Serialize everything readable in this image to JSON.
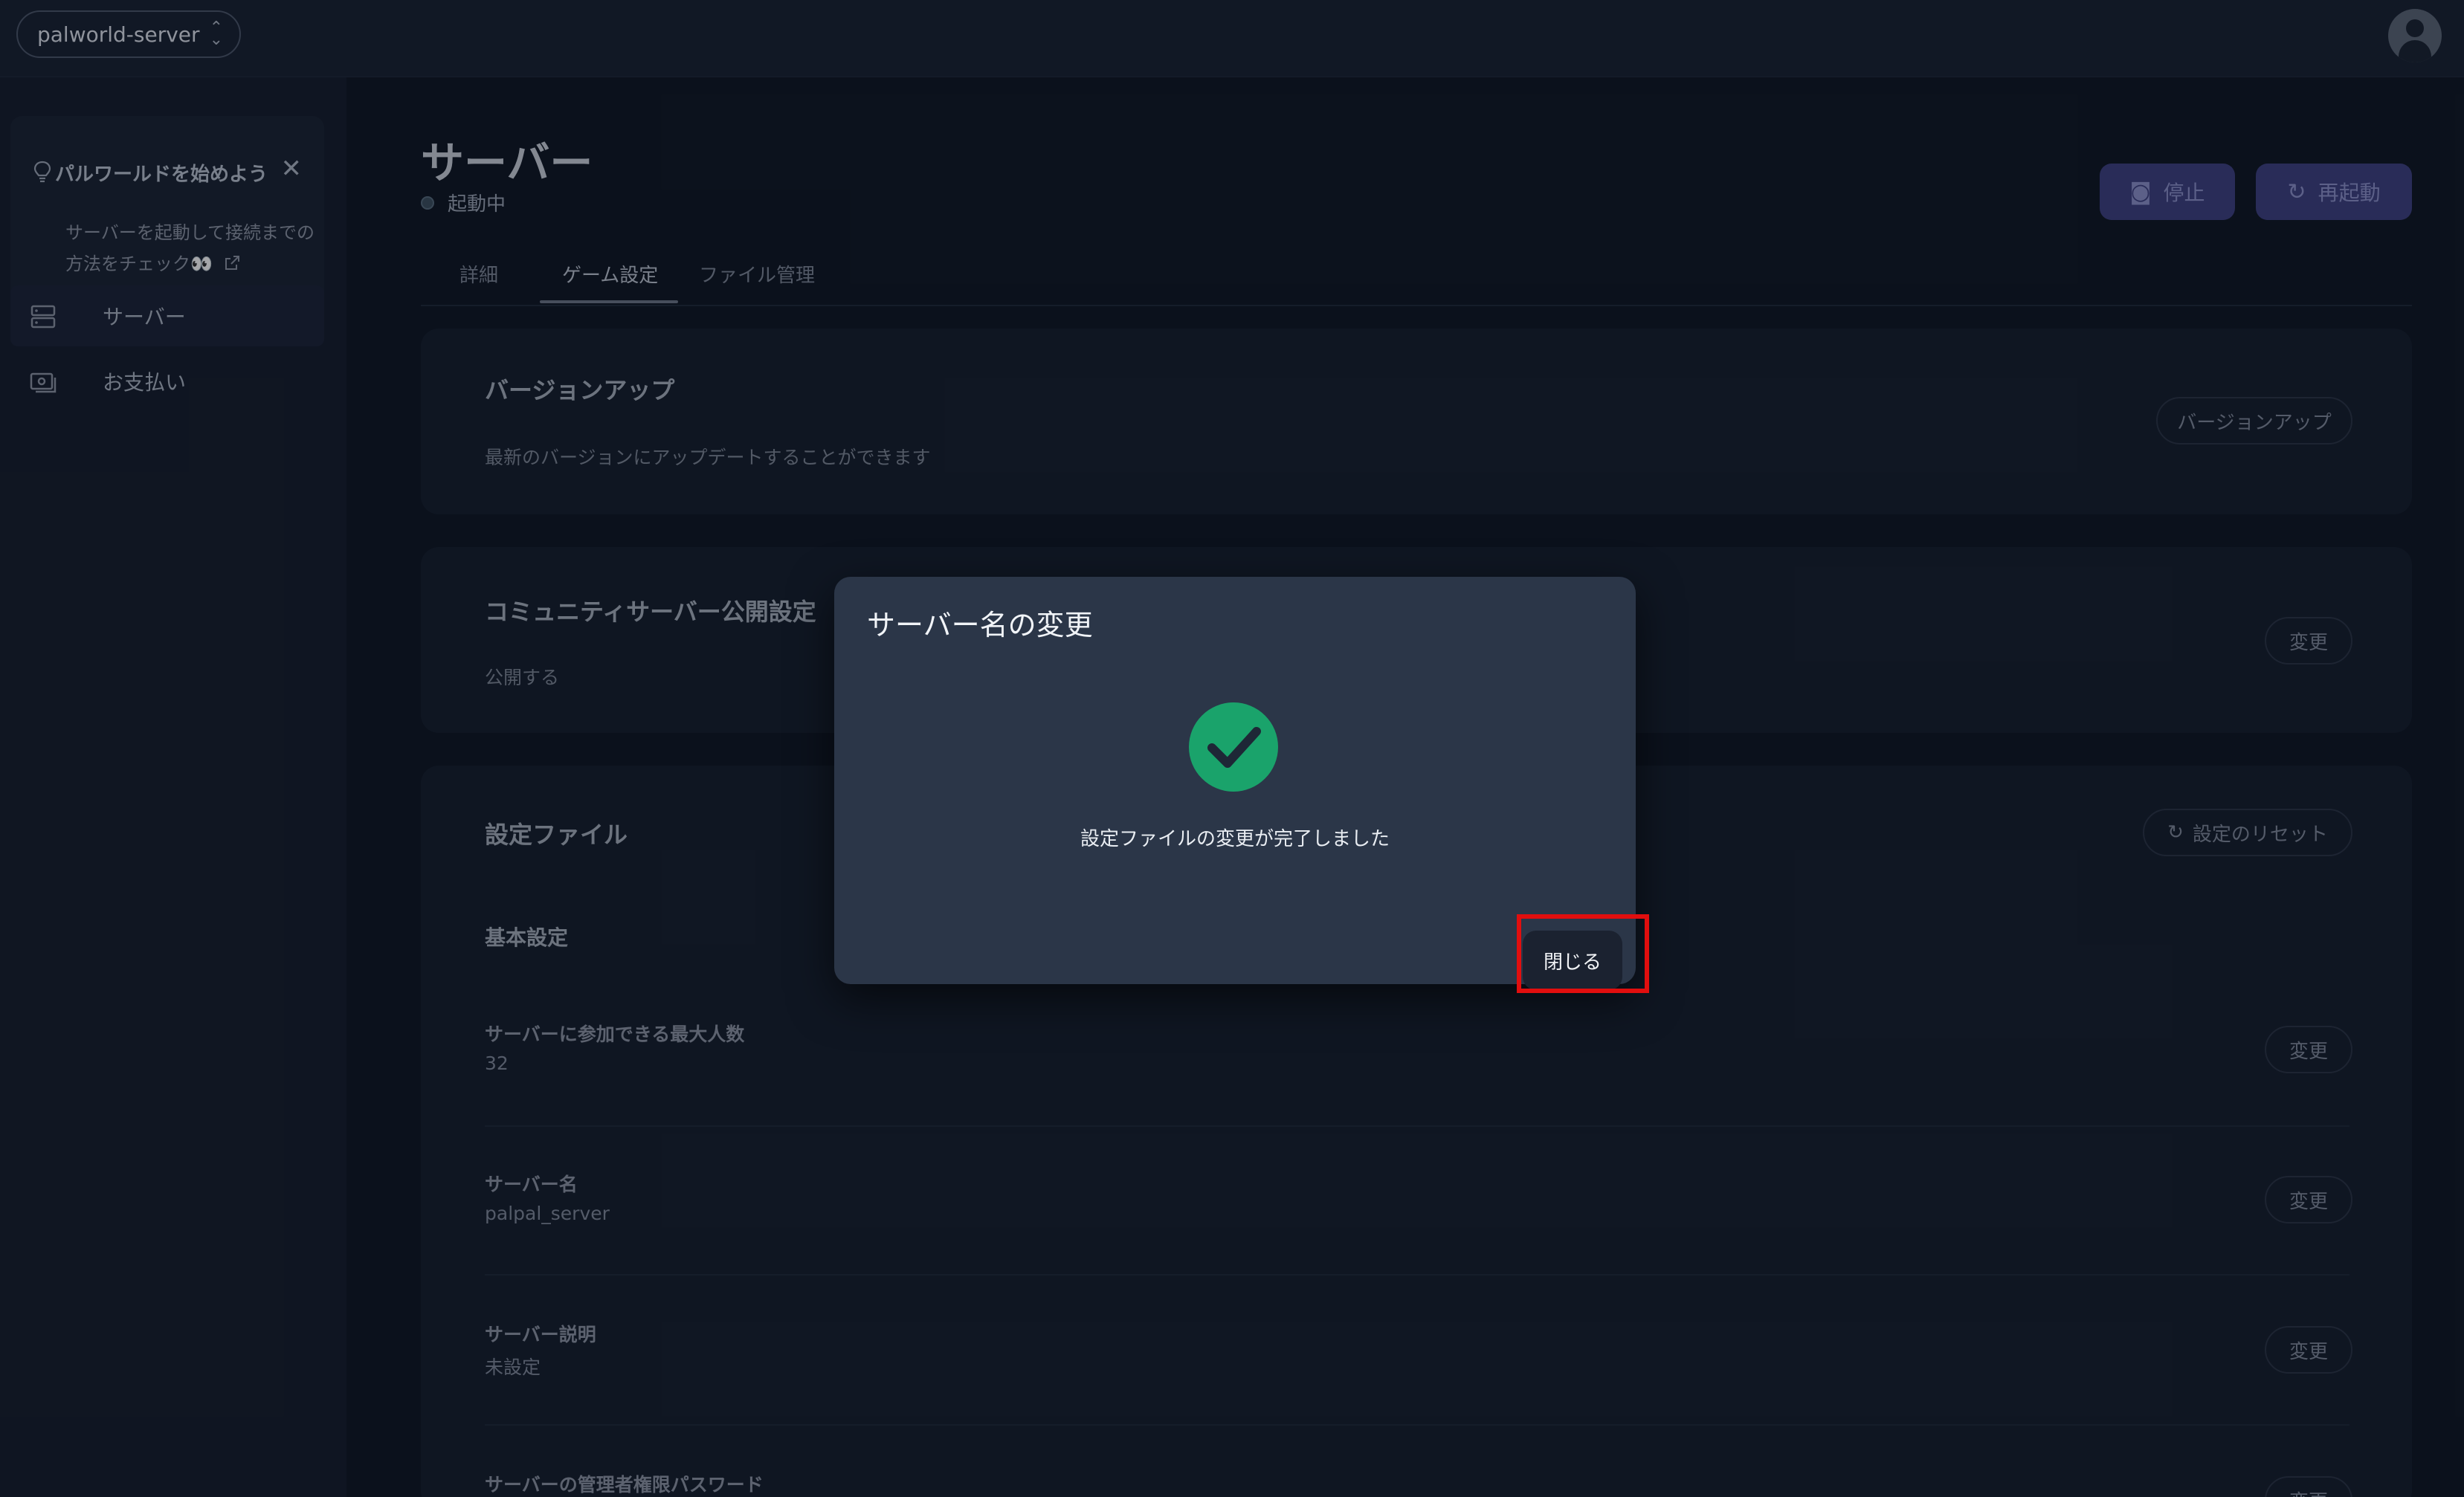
{
  "topbar": {
    "server_name": "palworld-server",
    "chevron": "⌃⌄"
  },
  "sidebar": {
    "tip": {
      "title": "パルワールドを始めよう",
      "body": "サーバーを起動して接続までの方法をチェック👀",
      "close": "✕"
    },
    "items": [
      {
        "label": "サーバー",
        "icon": "server-icon"
      },
      {
        "label": "お支払い",
        "icon": "payment-icon"
      }
    ]
  },
  "header": {
    "title": "サーバー",
    "status": "起動中",
    "stop_label": "停止",
    "restart_label": "再起動"
  },
  "tabs": [
    {
      "label": "詳細"
    },
    {
      "label": "ゲーム設定"
    },
    {
      "label": "ファイル管理"
    }
  ],
  "version_card": {
    "title": "バージョンアップ",
    "description": "最新のバージョンにアップデートすることができます",
    "button": "バージョンアップ"
  },
  "community_card": {
    "title": "コミュニティサーバー公開設定",
    "value": "公開する",
    "button": "変更"
  },
  "config_card": {
    "title": "設定ファイル",
    "reset_button": "設定のリセット",
    "section": "基本設定",
    "settings": [
      {
        "label": "サーバーに参加できる最大人数",
        "value": "32",
        "button": "変更"
      },
      {
        "label": "サーバー名",
        "value": "palpal_server",
        "button": "変更"
      },
      {
        "label": "サーバー説明",
        "value": "未設定",
        "button": "変更"
      },
      {
        "label": "サーバーの管理者権限パスワード",
        "value": "",
        "button": "変更"
      }
    ]
  },
  "modal": {
    "title": "サーバー名の変更",
    "message": "設定ファイルの変更が完了しました",
    "close_label": "閉じる",
    "success_color": "#1aa36b"
  }
}
